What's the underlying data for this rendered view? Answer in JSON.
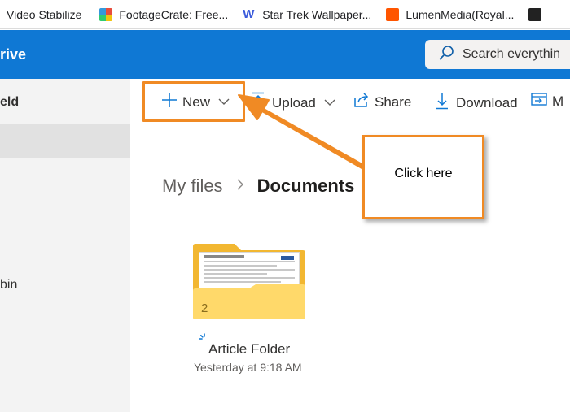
{
  "bookmarks": [
    {
      "label": "Video Stabilize",
      "icon": "none"
    },
    {
      "label": "FootageCrate: Free...",
      "icon": "footagecrate-icon"
    },
    {
      "label": "Star Trek Wallpaper...",
      "icon": "w-logo-icon"
    },
    {
      "label": "LumenMedia(Royal...",
      "icon": "soundcloud-icon"
    },
    {
      "label": "",
      "icon": "avatar-icon"
    }
  ],
  "header": {
    "app_name": "rive",
    "search_placeholder": "Search everythin"
  },
  "sidebar": {
    "user_name": "eld",
    "bin_label": "bin"
  },
  "commands": {
    "new_label": "New",
    "upload_label": "Upload",
    "share_label": "Share",
    "download_label": "Download",
    "move_label": "M"
  },
  "breadcrumb": {
    "root": "My files",
    "current": "Documents"
  },
  "callout": {
    "text": "Click here"
  },
  "folder": {
    "count": "2",
    "name": "Article Folder",
    "modified": "Yesterday at 9:18 AM"
  },
  "colors": {
    "header_blue": "#0f78d4",
    "annotation_orange": "#f08a24",
    "folder_yellow": "#ffd96a",
    "sidebar_gray": "#f3f3f3"
  }
}
